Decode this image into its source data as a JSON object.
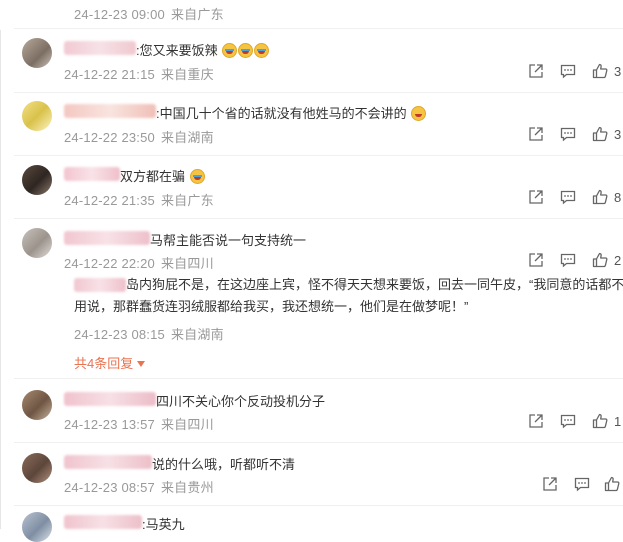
{
  "top_meta": {
    "time": "24-12-23 09:00",
    "from": "来自广东"
  },
  "comments": [
    {
      "text": ":您又来要饭辣",
      "emoji_count": 3,
      "time": "24-12-22 21:15",
      "from": "来自重庆",
      "likes": "3"
    },
    {
      "text": ":中国几十个省的话就没有他姓马的不会讲的",
      "emoji_count": 1,
      "time": "24-12-22 23:50",
      "from": "来自湖南",
      "likes": "3"
    },
    {
      "text": "双方都在骗",
      "emoji_count": 1,
      "time": "24-12-22 21:35",
      "from": "来自广东",
      "likes": "8"
    },
    {
      "text": "马帮主能否说一句支持统一",
      "emoji_count": 0,
      "time": "24-12-22 22:20",
      "from": "来自四川",
      "likes": "2",
      "reply": {
        "text": "岛内狗屁不是，在这边座上宾，怪不得天天想来要饭，回去一同午皮，“我同意的话都不用说，那群蠢货连羽绒服都给我买，我还想统一，他们是在做梦呢！”",
        "time": "24-12-23 08:15",
        "from": "来自湖南"
      },
      "more_replies": "共4条回复"
    },
    {
      "text": "四川不关心你个反动投机分子",
      "emoji_count": 0,
      "time": "24-12-23 13:57",
      "from": "来自四川",
      "likes": "1"
    },
    {
      "text": "说的什么哦，听都听不清",
      "emoji_count": 0,
      "time": "24-12-23 08:57",
      "from": "来自贵州",
      "likes": ""
    },
    {
      "text": ":马英九",
      "emoji_count": 0,
      "time": "",
      "from": "",
      "likes": ""
    }
  ],
  "icons": {
    "share": "share-icon",
    "comment": "comment-icon",
    "like": "thumbs-up-icon",
    "expand": "caret-down-icon"
  },
  "colors": {
    "accent": "#eb7350",
    "meta_text": "#999999",
    "body_text": "#333333"
  }
}
